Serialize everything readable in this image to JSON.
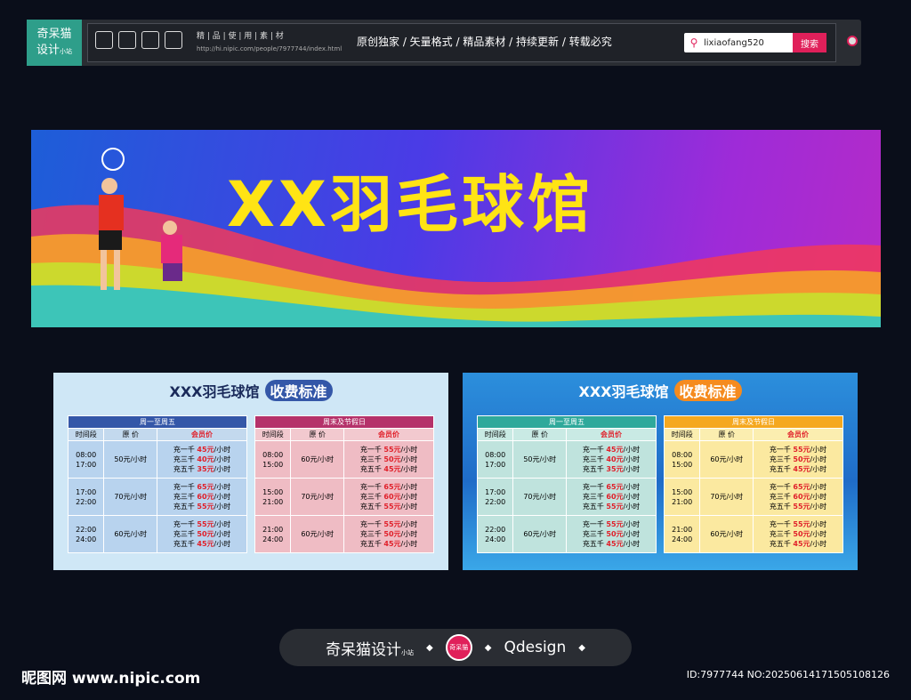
{
  "topbar": {
    "logo_line1": "奇呆猫",
    "logo_line2": "设计",
    "logo_small": "小站",
    "toolbar_info": "精 | 品 | 使 | 用 | 素 | 材",
    "url": "http://hi.nipic.com/people/7977744/index.html",
    "slogan": "原创独家 / 矢量格式 / 精品素材 / 持续更新 / 转载必究",
    "search_value": "lixiaofang520",
    "search_button": "搜索"
  },
  "banner": {
    "title": "XX羽毛球馆"
  },
  "panel_left": {
    "title_main": "XXX羽毛球馆",
    "title_pill": "收费标准",
    "weekday": {
      "header": "周一至周五",
      "cols": [
        "时间段",
        "原 价",
        "会员价"
      ],
      "rows": [
        {
          "time": "08:00\n17:00",
          "price": "50元/小时",
          "m1": "充一千 45元/小时",
          "m2": "充三千 40元/小时",
          "m3": "充五千 35元/小时"
        },
        {
          "time": "17:00\n22:00",
          "price": "70元/小时",
          "m1": "充一千 65元/小时",
          "m2": "充三千 60元/小时",
          "m3": "充五千 55元/小时"
        },
        {
          "time": "22:00\n24:00",
          "price": "60元/小时",
          "m1": "充一千 55元/小时",
          "m2": "充三千 50元/小时",
          "m3": "充五千 45元/小时"
        }
      ]
    },
    "weekend": {
      "header": "周末及节假日",
      "cols": [
        "时间段",
        "原 价",
        "会员价"
      ],
      "rows": [
        {
          "time": "08:00\n15:00",
          "price": "60元/小时",
          "m1": "充一千 55元/小时",
          "m2": "充三千 50元/小时",
          "m3": "充五千 45元/小时"
        },
        {
          "time": "15:00\n21:00",
          "price": "70元/小时",
          "m1": "充一千 65元/小时",
          "m2": "充三千 60元/小时",
          "m3": "充五千 55元/小时"
        },
        {
          "time": "21:00\n24:00",
          "price": "60元/小时",
          "m1": "充一千 55元/小时",
          "m2": "充三千 50元/小时",
          "m3": "充五千 45元/小时"
        }
      ]
    }
  },
  "panel_right": {
    "title_main": "XXX羽毛球馆",
    "title_pill": "收费标准",
    "weekday": {
      "header": "周一至周五",
      "cols": [
        "时间段",
        "原 价",
        "会员价"
      ],
      "rows": [
        {
          "time": "08:00\n17:00",
          "price": "50元/小时",
          "m1": "充一千 45元/小时",
          "m2": "充三千 40元/小时",
          "m3": "充五千 35元/小时"
        },
        {
          "time": "17:00\n22:00",
          "price": "70元/小时",
          "m1": "充一千 65元/小时",
          "m2": "充三千 60元/小时",
          "m3": "充五千 55元/小时"
        },
        {
          "time": "22:00\n24:00",
          "price": "60元/小时",
          "m1": "充一千 55元/小时",
          "m2": "充三千 50元/小时",
          "m3": "充五千 45元/小时"
        }
      ]
    },
    "weekend": {
      "header": "周末及节假日",
      "cols": [
        "时间段",
        "原 价",
        "会员价"
      ],
      "rows": [
        {
          "time": "08:00\n15:00",
          "price": "60元/小时",
          "m1": "充一千 55元/小时",
          "m2": "充三千 50元/小时",
          "m3": "充五千 45元/小时"
        },
        {
          "time": "15:00\n21:00",
          "price": "70元/小时",
          "m1": "充一千 65元/小时",
          "m2": "充三千 60元/小时",
          "m3": "充五千 55元/小时"
        },
        {
          "time": "21:00\n24:00",
          "price": "60元/小时",
          "m1": "充一千 55元/小时",
          "m2": "充三千 50元/小时",
          "m3": "充五千 45元/小时"
        }
      ]
    }
  },
  "footer": {
    "brand": "奇呆猫设计",
    "brand_small": "小站",
    "emblem": "奇呆猫",
    "qdesign": "Qdesign",
    "site": "昵图网 www.nipic.com",
    "id": "ID:7977744 NO:20250614171505108126"
  },
  "colors": {
    "accent": "#e0205a",
    "banner_title": "#ffe414",
    "left_weekday_header": "#3457a8",
    "left_weekend_header": "#b5326a",
    "right_weekday_header": "#2fa99b",
    "right_weekend_header": "#f5a81f"
  }
}
